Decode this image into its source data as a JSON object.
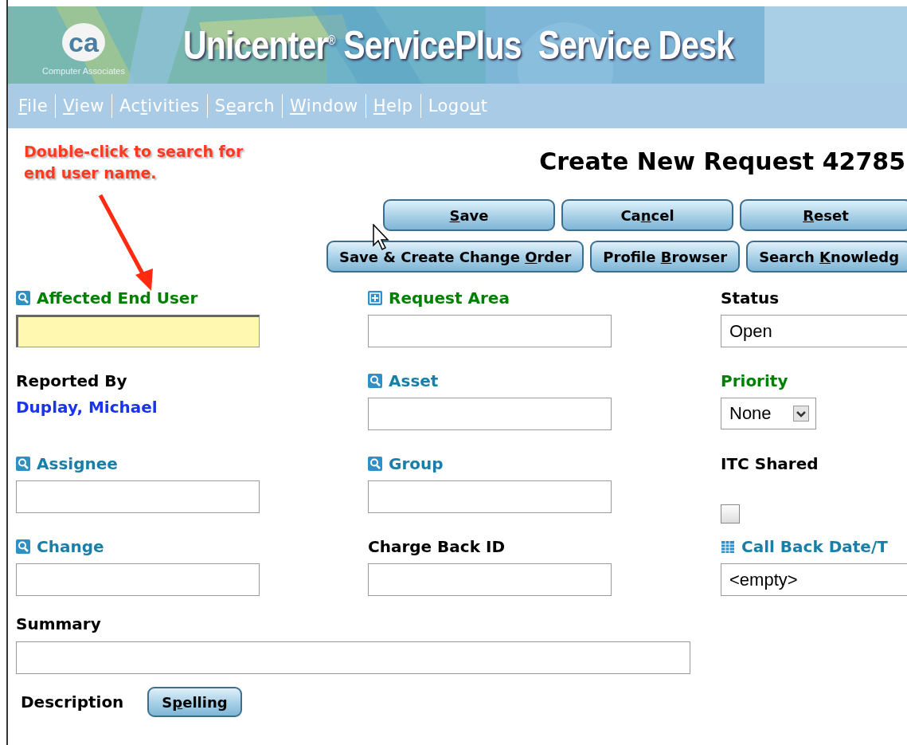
{
  "header": {
    "logo_text": "ca",
    "company": "Computer Associates",
    "title": "Unicenter$^{®}$ ServicePlus  Service Desk"
  },
  "menu": [
    {
      "key": "F",
      "after": "ile"
    },
    {
      "key": "V",
      "after": "iew"
    },
    {
      "before": "Ac",
      "key": "t",
      "after": "ivities"
    },
    {
      "before": "S",
      "key": "e",
      "after": "arch"
    },
    {
      "key": "W",
      "after": "indow"
    },
    {
      "key": "H",
      "after": "elp"
    },
    {
      "before": "Logo",
      "key": "u",
      "after": "t"
    }
  ],
  "annotation": "Double-click to search for end user name.",
  "page_title": "Create New Request 42785",
  "button_rows": [
    [
      {
        "key": "S",
        "after": "ave"
      },
      {
        "before": "Ca",
        "key": "n",
        "after": "cel"
      },
      {
        "key": "R",
        "after": "eset"
      }
    ],
    [
      {
        "before": "Save & Create Change ",
        "key": "O",
        "after": "rder"
      },
      {
        "before": "Profile ",
        "key": "B",
        "after": "rowser"
      },
      {
        "before": "Search ",
        "key": "K",
        "after": "nowledg"
      }
    ]
  ],
  "field_rows": [
    [
      {
        "label": "Affected End User",
        "color": "#008000",
        "kind": "lookup-input",
        "focused": true
      },
      {
        "label": "Request Area",
        "color": "#008000",
        "kind": "tree-input"
      },
      {
        "label": "Status",
        "color": "#000000",
        "kind": "input",
        "value": "Open"
      }
    ],
    [
      {
        "label": "Reported By",
        "color": "#000000",
        "kind": "link",
        "value": "Duplay, Michael"
      },
      {
        "label": "Asset",
        "color": "#1a7fa8",
        "kind": "lookup-input"
      },
      {
        "label": "Priority",
        "color": "#008000",
        "kind": "select",
        "value": "None"
      }
    ],
    [
      {
        "label": "Assignee",
        "color": "#1a7fa8",
        "kind": "lookup-input"
      },
      {
        "label": "Group",
        "color": "#1a7fa8",
        "kind": "lookup-input"
      },
      {
        "label": "ITC Shared",
        "color": "#000000",
        "kind": "checkbox",
        "checked": false
      }
    ],
    [
      {
        "label": "Change",
        "color": "#1a7fa8",
        "kind": "lookup-input"
      },
      {
        "label": "Charge Back ID",
        "color": "#000000",
        "kind": "input"
      },
      {
        "label": "Call Back Date/T",
        "color": "#1a7fa8",
        "kind": "date-input",
        "value": "<empty>"
      }
    ]
  ],
  "summary": {
    "label": "Summary"
  },
  "description": {
    "label": "Description",
    "spelling": {
      "before": "S",
      "key": "p",
      "after": "elling"
    }
  }
}
